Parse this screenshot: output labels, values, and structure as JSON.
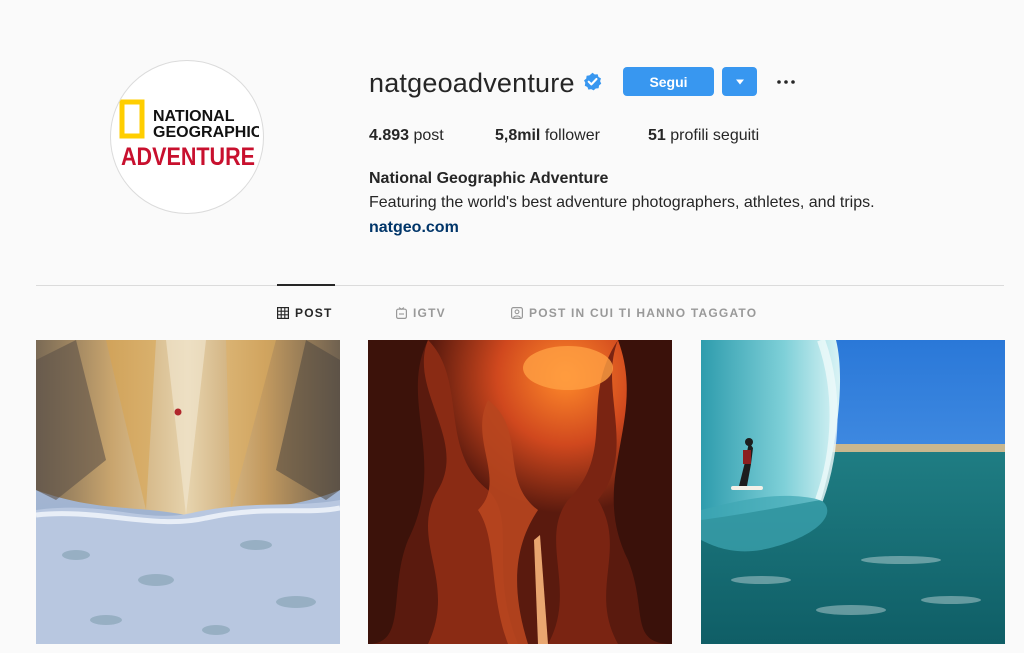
{
  "profile": {
    "username": "natgeoadventure",
    "follow_label": "Segui",
    "full_name": "National Geographic Adventure",
    "bio": "Featuring the world's best adventure photographers, athletes, and trips.",
    "link": "natgeo.com",
    "avatar_logo": {
      "line1": "NATIONAL",
      "line2": "GEOGRAPHIC",
      "line3": "ADVENTURE"
    }
  },
  "stats": {
    "posts_value": "4.893",
    "posts_label": "post",
    "followers_value": "5,8mil",
    "followers_label": "follower",
    "following_value": "51",
    "following_label": "profili seguiti"
  },
  "tabs": [
    {
      "label": "POST",
      "icon": "grid-icon",
      "active": true
    },
    {
      "label": "IGTV",
      "icon": "igtv-icon",
      "active": false
    },
    {
      "label": "POST IN CUI TI HANNO TAGGATO",
      "icon": "tagged-icon",
      "active": false
    }
  ],
  "posts": [
    {
      "subject": "climber on frozen cliff aerial"
    },
    {
      "subject": "slot canyon red rock"
    },
    {
      "subject": "surfer in barrel wave"
    }
  ],
  "colors": {
    "accent": "#3897f0",
    "link": "#003569",
    "logo_yellow": "#ffce00",
    "logo_red": "#c8102e"
  }
}
